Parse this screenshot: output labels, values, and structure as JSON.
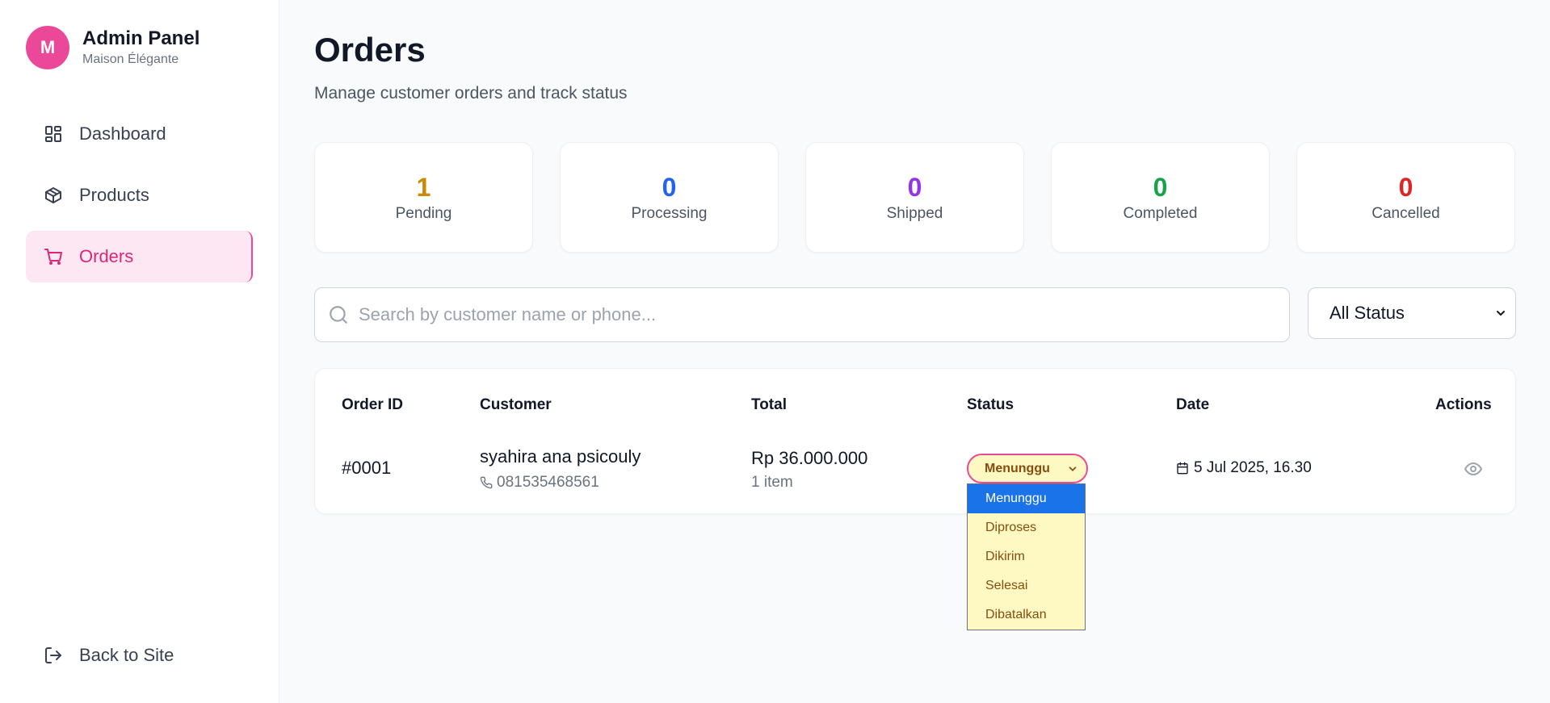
{
  "brand": {
    "avatar_letter": "M",
    "title": "Admin Panel",
    "subtitle": "Maison Élégante"
  },
  "sidebar": {
    "items": [
      {
        "label": "Dashboard",
        "icon": "dashboard-icon",
        "active": false
      },
      {
        "label": "Products",
        "icon": "package-icon",
        "active": false
      },
      {
        "label": "Orders",
        "icon": "cart-icon",
        "active": true
      }
    ],
    "back_label": "Back to Site"
  },
  "page": {
    "title": "Orders",
    "subtitle": "Manage customer orders and track status"
  },
  "stats": [
    {
      "value": "1",
      "label": "Pending",
      "color": "#ca8a04"
    },
    {
      "value": "0",
      "label": "Processing",
      "color": "#2563eb"
    },
    {
      "value": "0",
      "label": "Shipped",
      "color": "#9333ea"
    },
    {
      "value": "0",
      "label": "Completed",
      "color": "#16a34a"
    },
    {
      "value": "0",
      "label": "Cancelled",
      "color": "#dc2626"
    }
  ],
  "search": {
    "placeholder": "Search by customer name or phone...",
    "value": ""
  },
  "filter": {
    "selected": "All Status"
  },
  "table": {
    "headers": [
      "Order ID",
      "Customer",
      "Total",
      "Status",
      "Date",
      "Actions"
    ],
    "rows": [
      {
        "order_id": "#0001",
        "customer_name": "syahira ana psicouly",
        "phone": "081535468561",
        "total": "Rp 36.000.000",
        "items": "1 item",
        "status": "Menunggu",
        "date": "5 Jul 2025, 16.30"
      }
    ]
  },
  "status_dropdown": {
    "options": [
      "Menunggu",
      "Diproses",
      "Dikirim",
      "Selesai",
      "Dibatalkan"
    ],
    "selected": "Menunggu"
  },
  "colors": {
    "accent": "#ec4899",
    "accent_bg": "#fce7f3",
    "pill_bg": "#fef9c3",
    "pill_text": "#854d0e",
    "dropdown_highlight": "#1a73e8"
  }
}
